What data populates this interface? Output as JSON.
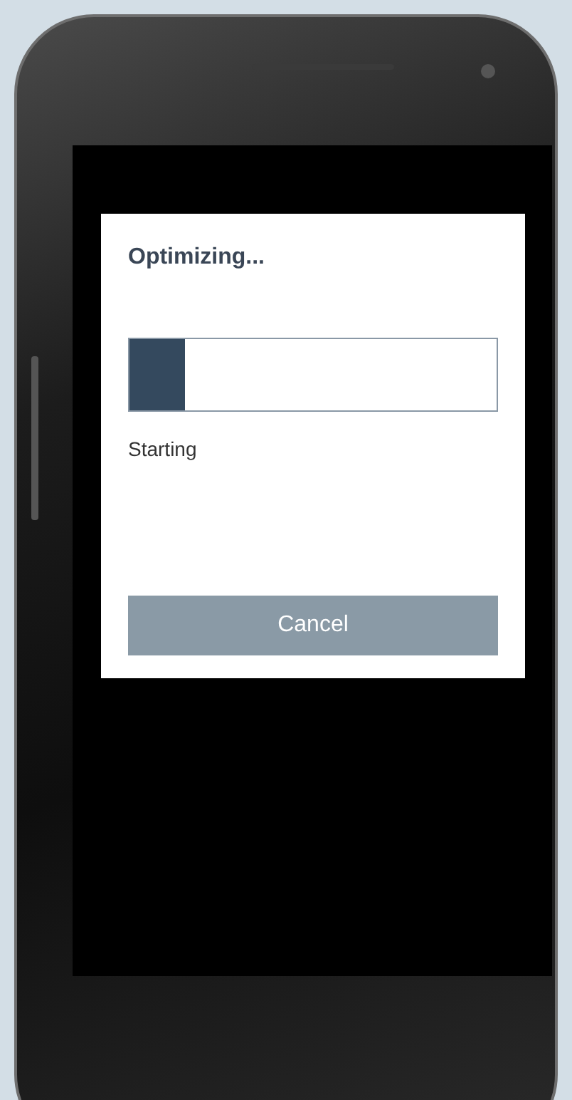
{
  "dialog": {
    "title": "Optimizing...",
    "progress": {
      "level": 0.15
    },
    "status": "Starting",
    "button": {
      "label": "Cancel"
    }
  }
}
